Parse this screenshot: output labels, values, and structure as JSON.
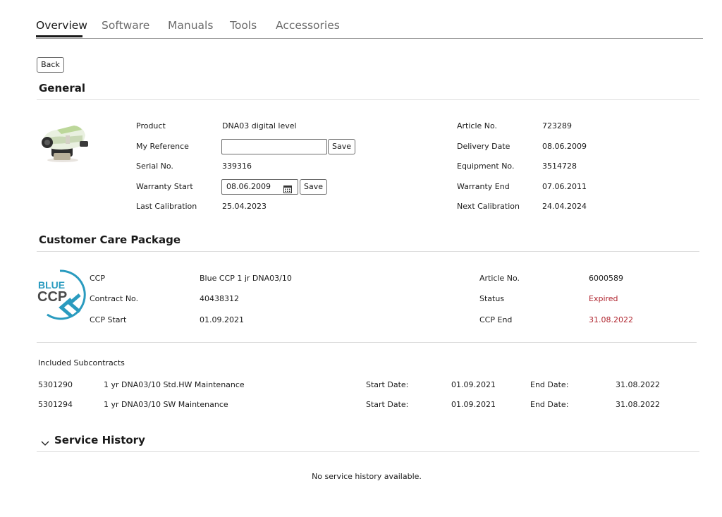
{
  "tabs": [
    {
      "label": "Overview",
      "active": true
    },
    {
      "label": "Software",
      "active": false
    },
    {
      "label": "Manuals",
      "active": false
    },
    {
      "label": "Tools",
      "active": false
    },
    {
      "label": "Accessories",
      "active": false
    }
  ],
  "back_label": "Back",
  "general": {
    "title": "General",
    "product_label": "Product",
    "product_value": "DNA03 digital level",
    "my_reference_label": "My Reference",
    "my_reference_value": "",
    "save_label": "Save",
    "serial_label": "Serial No.",
    "serial_value": "339316",
    "warranty_start_label": "Warranty Start",
    "warranty_start_value": "08.06.2009",
    "last_calibration_label": "Last Calibration",
    "last_calibration_value": "25.04.2023",
    "article_label": "Article No.",
    "article_value": "723289",
    "delivery_label": "Delivery Date",
    "delivery_value": "08.06.2009",
    "equipment_label": "Equipment No.",
    "equipment_value": "3514728",
    "warranty_end_label": "Warranty End",
    "warranty_end_value": "07.06.2011",
    "next_calibration_label": "Next Calibration",
    "next_calibration_value": "24.04.2024"
  },
  "ccp": {
    "title": "Customer Care Package",
    "logo_text_top": "BLUE",
    "logo_text_main": "CCP",
    "ccp_label": "CCP",
    "ccp_value": "Blue CCP 1 jr DNA03/10",
    "contract_label": "Contract No.",
    "contract_value": "40438312",
    "start_label": "CCP Start",
    "start_value": "01.09.2021",
    "article_label": "Article No.",
    "article_value": "6000589",
    "status_label": "Status",
    "status_value": "Expired",
    "end_label": "CCP End",
    "end_value": "31.08.2022",
    "alert_color": "#b0252f",
    "logo_color": "#2a9bbf",
    "included_label": "Included Subcontracts",
    "subcontracts": [
      {
        "id": "5301290",
        "desc": "1 yr DNA03/10 Std.HW Maintenance",
        "start_label": "Start Date:",
        "start": "01.09.2021",
        "end_label": "End Date:",
        "end": "31.08.2022"
      },
      {
        "id": "5301294",
        "desc": "1 yr DNA03/10 SW Maintenance",
        "start_label": "Start Date:",
        "start": "01.09.2021",
        "end_label": "End Date:",
        "end": "31.08.2022"
      }
    ]
  },
  "service": {
    "title": "Service History",
    "empty": "No service history available."
  },
  "icons": {
    "calendar": "calendar-icon",
    "chevron": "chevron-down-icon",
    "product": "product-image",
    "logo": "blue-ccp-logo"
  }
}
